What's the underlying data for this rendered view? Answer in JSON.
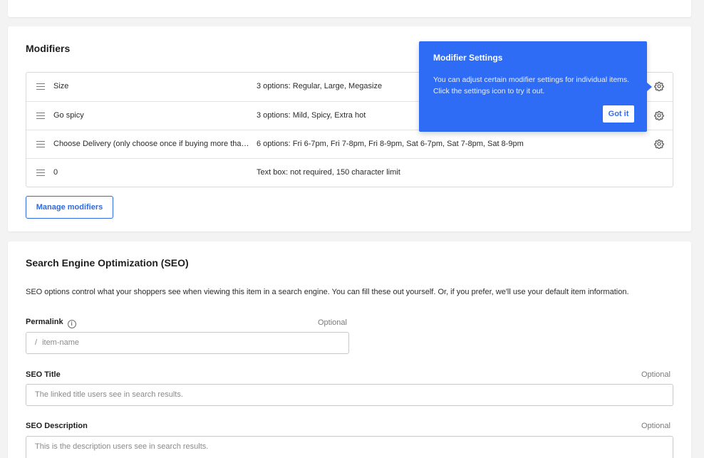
{
  "modifiers": {
    "title": "Modifiers",
    "rows": [
      {
        "name": "Size",
        "options": "3 options: Regular, Large, Megasize",
        "has_gear": true
      },
      {
        "name": "Go spicy",
        "options": "3 options: Mild, Spicy, Extra hot",
        "has_gear": true
      },
      {
        "name": "Choose Delivery (only choose once if buying more than one)",
        "options": "6 options: Fri 6-7pm, Fri 7-8pm, Fri 8-9pm, Sat 6-7pm, Sat 7-8pm, Sat 8-9pm",
        "has_gear": true
      },
      {
        "name": "0",
        "options": "Text box: not required, 150 character limit",
        "has_gear": false
      }
    ],
    "manage_button": "Manage modifiers"
  },
  "tooltip": {
    "title": "Modifier Settings",
    "body": "You can adjust certain modifier settings for individual items. Click the settings icon to try it out.",
    "button": "Got it"
  },
  "seo": {
    "title": "Search Engine Optimization (SEO)",
    "description": "SEO options control what your shoppers see when viewing this item in a search engine. You can fill these out yourself. Or, if you prefer, we'll use your default item information.",
    "permalink": {
      "label": "Permalink",
      "optional": "Optional",
      "prefix": "/",
      "placeholder": "item-name"
    },
    "seo_title": {
      "label": "SEO Title",
      "optional": "Optional",
      "placeholder": "The linked title users see in search results."
    },
    "seo_description": {
      "label": "SEO Description",
      "optional": "Optional",
      "placeholder": "This is the description users see in search results."
    }
  },
  "colors": {
    "accent": "#2f6ae0",
    "tooltip_bg": "#2f6cf5",
    "page_bg": "#f3f3f4"
  },
  "icons": {
    "drag": "drag-handle-icon",
    "gear": "gear-icon",
    "info": "info-icon"
  }
}
